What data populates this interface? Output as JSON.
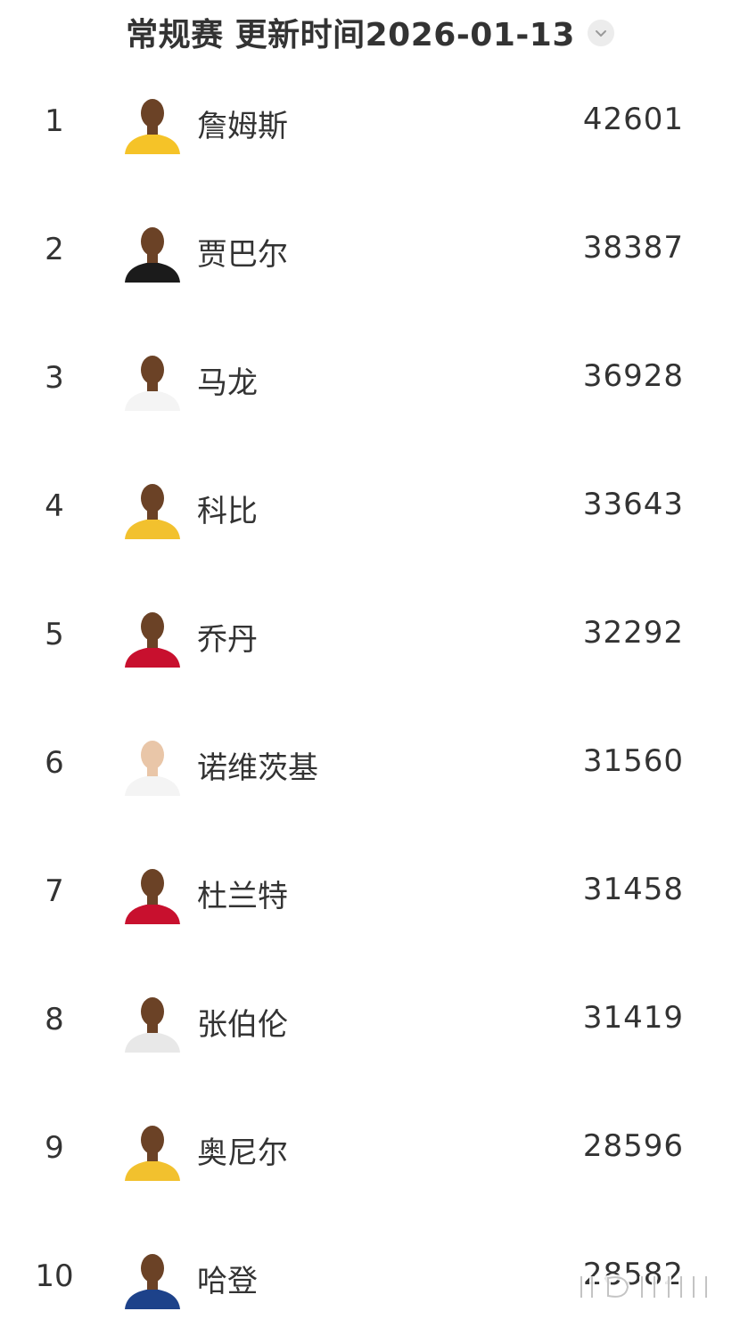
{
  "header": {
    "title": "常规赛 更新时间2026-01-13",
    "dropdown_icon": "chevron-down-icon"
  },
  "rows": [
    {
      "rank": "1",
      "name": "詹姆斯",
      "value": "42601",
      "jersey": "#f5c328"
    },
    {
      "rank": "2",
      "name": "贾巴尔",
      "value": "38387",
      "jersey": "#1b1b1b"
    },
    {
      "rank": "3",
      "name": "马龙",
      "value": "36928",
      "jersey": "#f4f4f4"
    },
    {
      "rank": "4",
      "name": "科比",
      "value": "33643",
      "jersey": "#f2c12e"
    },
    {
      "rank": "5",
      "name": "乔丹",
      "value": "32292",
      "jersey": "#c8102e"
    },
    {
      "rank": "6",
      "name": "诺维茨基",
      "value": "31560",
      "jersey": "#f4f4f4"
    },
    {
      "rank": "7",
      "name": "杜兰特",
      "value": "31458",
      "jersey": "#c8102e"
    },
    {
      "rank": "8",
      "name": "张伯伦",
      "value": "31419",
      "jersey": "#e8e8e8"
    },
    {
      "rank": "9",
      "name": "奥尼尔",
      "value": "28596",
      "jersey": "#f2c12e"
    },
    {
      "rank": "10",
      "name": "哈登",
      "value": "28582",
      "jersey": "#1d428a"
    }
  ],
  "colors": {
    "text": "#333333",
    "background": "#ffffff",
    "skin_dark": "#6b4226",
    "skin_light": "#e9c6a8"
  }
}
